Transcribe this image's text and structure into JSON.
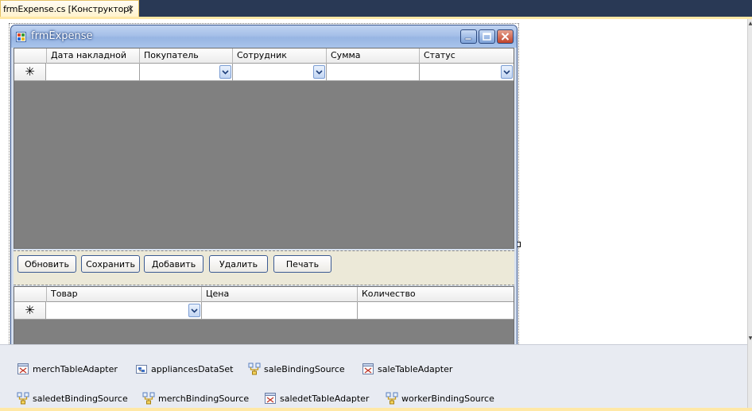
{
  "document_tab": {
    "title": "frmExpense.cs [Конструктор]",
    "close_glyph": "×"
  },
  "form": {
    "title": "frmExpense"
  },
  "grid_top": {
    "columns": [
      "Дата накладной",
      "Покупатель",
      "Сотрудник",
      "Сумма",
      "Статус"
    ],
    "new_row_glyph": "✳"
  },
  "buttons": [
    "Обновить",
    "Сохранить",
    "Добавить",
    "Удалить",
    "Печать"
  ],
  "grid_bottom": {
    "columns": [
      "Товар",
      "Цена",
      "Количество"
    ],
    "new_row_glyph": "✳"
  },
  "tray": {
    "row1": [
      {
        "label": "merchTableAdapter",
        "icon": "table-adapter-icon"
      },
      {
        "label": "appliancesDataSet",
        "icon": "dataset-icon"
      },
      {
        "label": "saleBindingSource",
        "icon": "binding-source-icon"
      },
      {
        "label": "saleTableAdapter",
        "icon": "table-adapter-icon"
      }
    ],
    "row2": [
      {
        "label": "saledetBindingSource",
        "icon": "binding-source-icon"
      },
      {
        "label": "merchBindingSource",
        "icon": "binding-source-icon"
      },
      {
        "label": "saledetTableAdapter",
        "icon": "table-adapter-icon"
      },
      {
        "label": "workerBindingSource",
        "icon": "binding-source-icon"
      }
    ]
  },
  "colors": {
    "ide_tab_strip": "#293955",
    "active_tab": "#fff3cd",
    "form_titlebar": "#a6c0e8",
    "grid_background": "#808080",
    "panel_background": "#ece9d8",
    "tray_background": "#e8ebf2"
  }
}
